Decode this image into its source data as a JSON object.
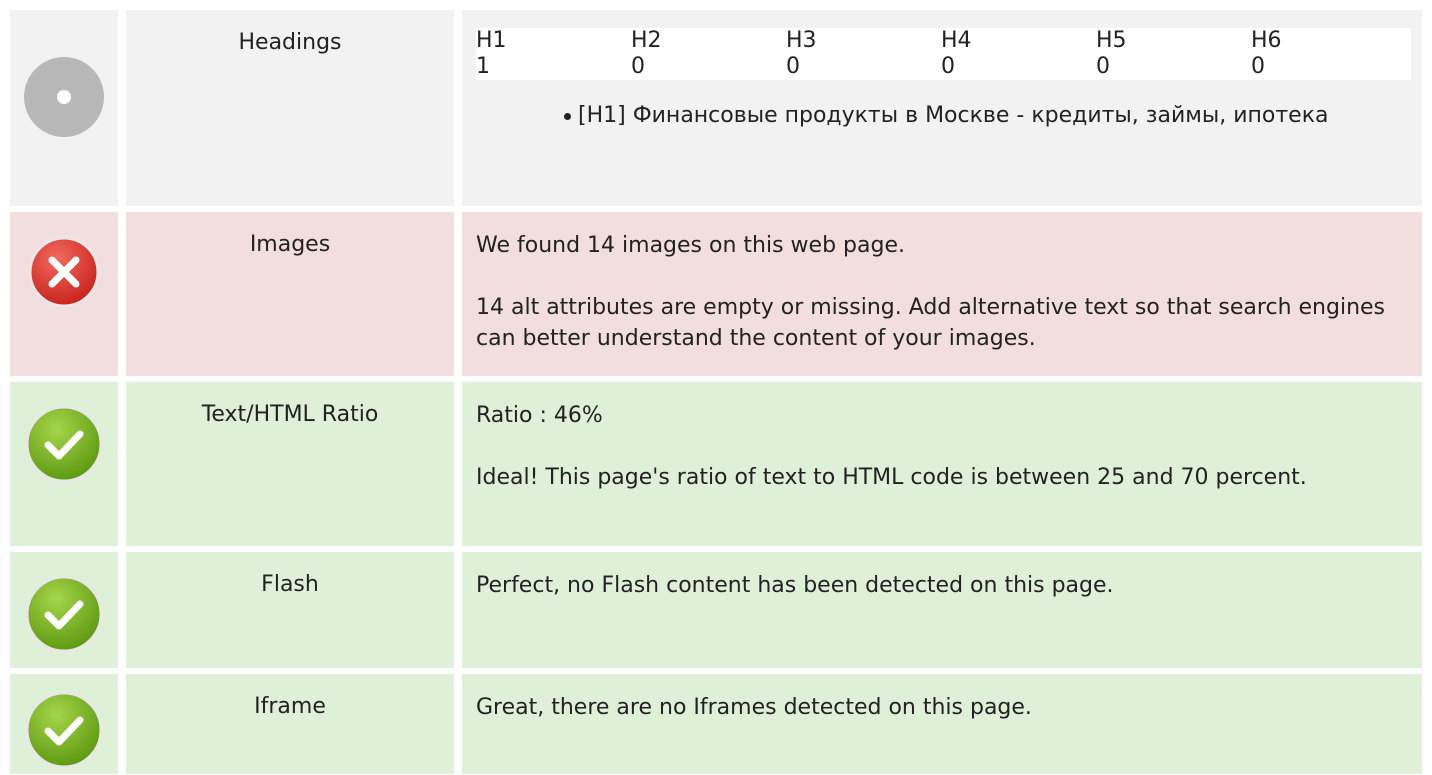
{
  "rows": [
    {
      "status": "neutral",
      "icon": "neutral-circle-icon",
      "label": "Headings",
      "headings": {
        "levels": [
          "H1",
          "H2",
          "H3",
          "H4",
          "H5",
          "H6"
        ],
        "counts": [
          "1",
          "0",
          "0",
          "0",
          "0",
          "0"
        ]
      },
      "items": [
        "[H1] Финансовые продукты в Москве - кредиты, займы, ипотека"
      ]
    },
    {
      "status": "bad",
      "icon": "error-x-icon",
      "label": "Images",
      "paragraphs": [
        "We found 14 images on this web page.",
        "14 alt attributes are empty or missing. Add alternative text so that search engines can better understand the content of your images."
      ]
    },
    {
      "status": "good",
      "icon": "check-icon",
      "label": "Text/HTML Ratio",
      "paragraphs": [
        "Ratio : 46%",
        "Ideal! This page's ratio of text to HTML code is between 25 and 70 percent."
      ]
    },
    {
      "status": "good",
      "icon": "check-icon",
      "label": "Flash",
      "paragraphs": [
        "Perfect, no Flash content has been detected on this page."
      ]
    },
    {
      "status": "good",
      "icon": "check-icon",
      "label": "Iframe",
      "paragraphs": [
        "Great, there are no Iframes detected on this page."
      ]
    }
  ],
  "colors": {
    "neutral_bg": "#f2f2f2",
    "bad_bg": "#f2dedf",
    "good_bg": "#dff0d8",
    "error_red": "#e0413b",
    "check_green": "#7ab51d",
    "neutral_gray": "#b8b8b8"
  }
}
